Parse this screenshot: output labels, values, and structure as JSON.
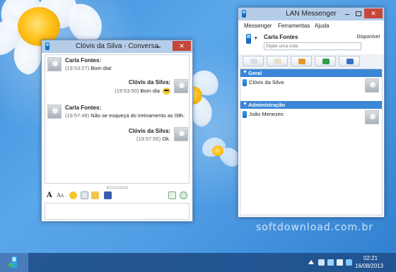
{
  "chat_window": {
    "title": "Clóvis da Silva - Conversa",
    "messages": [
      {
        "sender": "Carla Fontes:",
        "time": "(19:53:27)",
        "text": "Bom dia!",
        "side": "left"
      },
      {
        "sender": "Clóvis da Silva:",
        "time": "(19:53:50)",
        "text": "Bom dia",
        "side": "right",
        "emoticon": "cool-smiley"
      },
      {
        "sender": "Carla Fontes:",
        "time": "(19:57:48)",
        "text": "Não se esqueça do treinamento as 09h.",
        "side": "left"
      },
      {
        "sender": "Clóvis da Silva:",
        "time": "(19:57:55)",
        "text": "Ok.",
        "side": "right"
      }
    ],
    "toolbar_icons": [
      "font-icon",
      "font-size-icon",
      "emoticon-icon",
      "send-file-icon",
      "folder-icon",
      "save-icon",
      "add-icon",
      "history-icon"
    ]
  },
  "messenger_window": {
    "title": "LAN Messenger",
    "menu": [
      "Messenger",
      "Ferramentas",
      "Ajuda"
    ],
    "user": {
      "name": "Carla Fontes",
      "status": "Disponível",
      "note_placeholder": "Digite uma nota"
    },
    "toolbar_icons": [
      "chat-icon",
      "broadcast-icon",
      "rss-icon",
      "transfer-icon",
      "settings-icon"
    ],
    "groups": [
      {
        "name": "Geral",
        "contacts": [
          "Clóvis da Silva"
        ]
      },
      {
        "name": "Administração",
        "contacts": [
          "João Menezes"
        ]
      }
    ]
  },
  "watermark": "softdownload.com.br",
  "taskbar": {
    "time": "02:21",
    "date": "16/08/2013"
  },
  "colors": {
    "accent": "#3b86d6",
    "titlebar": "#b5cde8",
    "close": "#c7463a",
    "taskbar": "#20508c"
  }
}
